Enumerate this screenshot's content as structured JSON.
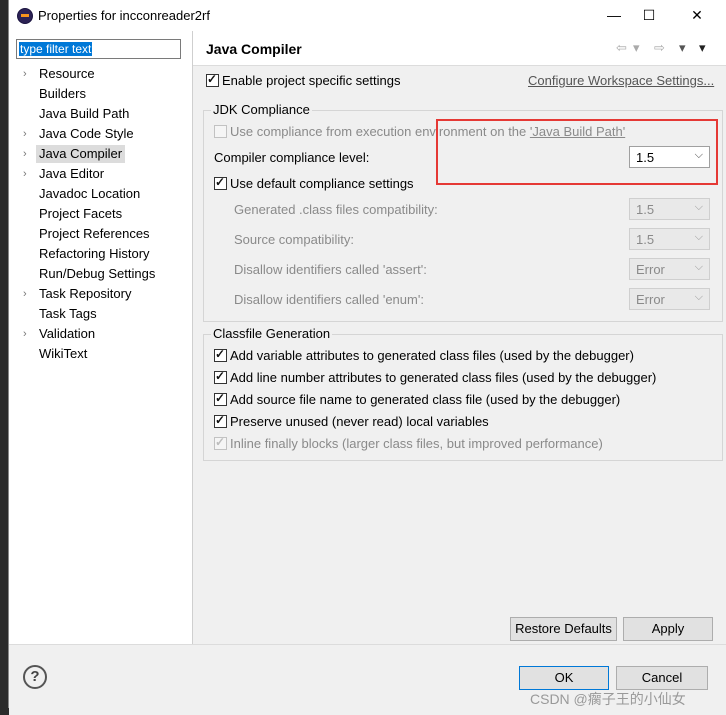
{
  "window": {
    "title": "Properties for incconreader2rf",
    "minimize": "—",
    "maximize": "☐",
    "close": "✕"
  },
  "sidebar": {
    "filter_text": "type filter text",
    "items": [
      {
        "label": "Resource",
        "expandable": true
      },
      {
        "label": "Builders",
        "expandable": false
      },
      {
        "label": "Java Build Path",
        "expandable": false
      },
      {
        "label": "Java Code Style",
        "expandable": true
      },
      {
        "label": "Java Compiler",
        "expandable": true,
        "selected": true
      },
      {
        "label": "Java Editor",
        "expandable": true
      },
      {
        "label": "Javadoc Location",
        "expandable": false
      },
      {
        "label": "Project Facets",
        "expandable": false
      },
      {
        "label": "Project References",
        "expandable": false
      },
      {
        "label": "Refactoring History",
        "expandable": false
      },
      {
        "label": "Run/Debug Settings",
        "expandable": false
      },
      {
        "label": "Task Repository",
        "expandable": true
      },
      {
        "label": "Task Tags",
        "expandable": false
      },
      {
        "label": "Validation",
        "expandable": true
      },
      {
        "label": "WikiText",
        "expandable": false
      }
    ]
  },
  "page": {
    "title": "Java Compiler",
    "enable_specific": "Enable project specific settings",
    "configure_link": "Configure Workspace Settings...",
    "jdk_group": "JDK Compliance",
    "use_compliance": "Use compliance from execution environment on the ",
    "use_compliance_link": "'Java Build Path'",
    "compliance_level_label": "Compiler compliance level:",
    "compliance_level_value": "1.5",
    "use_default": "Use default compliance settings",
    "generated_label": "Generated .class files compatibility:",
    "generated_value": "1.5",
    "source_label": "Source compatibility:",
    "source_value": "1.5",
    "assert_label": "Disallow identifiers called 'assert':",
    "assert_value": "Error",
    "enum_label": "Disallow identifiers called 'enum':",
    "enum_value": "Error",
    "classfile_group": "Classfile Generation",
    "cf1": "Add variable attributes to generated class files (used by the debugger)",
    "cf2": "Add line number attributes to generated class files (used by the debugger)",
    "cf3": "Add source file name to generated class file (used by the debugger)",
    "cf4": "Preserve unused (never read) local variables",
    "cf5": "Inline finally blocks (larger class files, but improved performance)",
    "restore_defaults": "Restore Defaults",
    "apply": "Apply"
  },
  "footer": {
    "help": "?",
    "ok": "OK",
    "cancel": "Cancel"
  },
  "watermark": "CSDN @瘸子王的小仙女"
}
